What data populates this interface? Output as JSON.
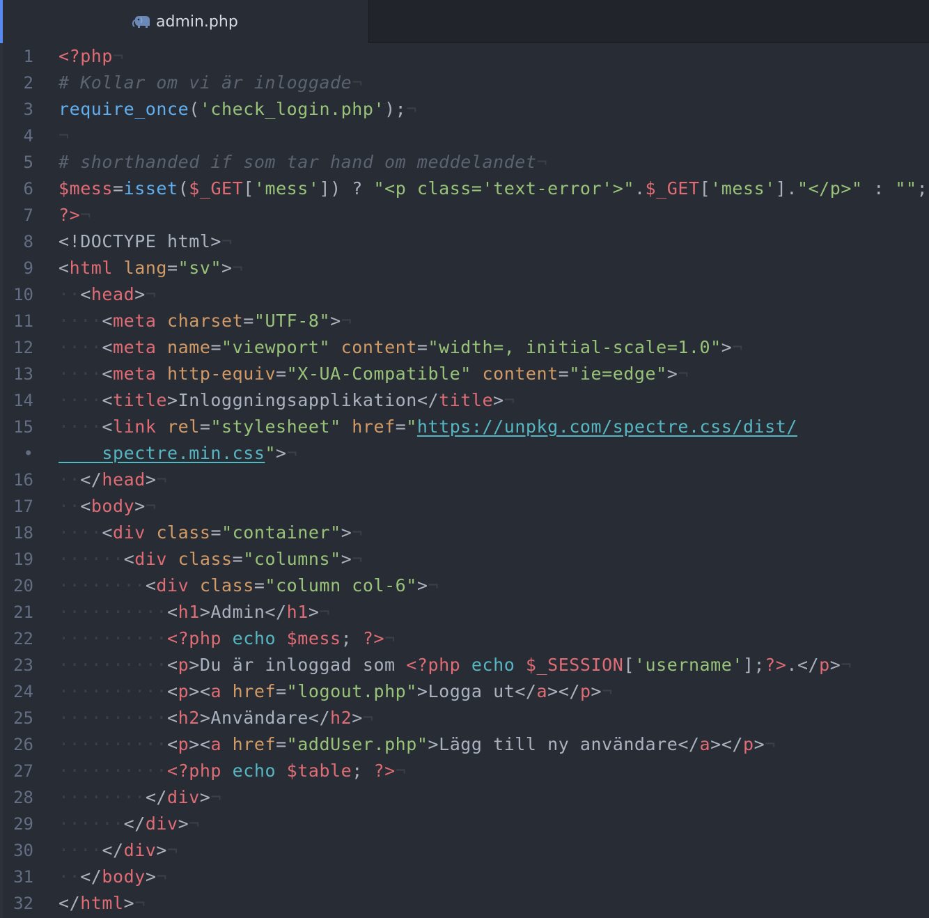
{
  "tab": {
    "filename": "admin.php",
    "icon": "php-elephant-icon"
  },
  "colors": {
    "background": "#282c34",
    "tab_bar": "#21252b",
    "accent": "#568af2",
    "gutter_text": "#636d83",
    "comment": "#5c6370",
    "tag": "#e06c75",
    "function": "#61afef",
    "string": "#98c379",
    "attribute": "#d19a66",
    "keyword": "#56b6c2",
    "plain": "#abb2bf",
    "invisible": "#3b4048"
  },
  "lines": [
    {
      "n": "1",
      "tokens": [
        [
          "ph",
          "<?php"
        ],
        [
          "eol",
          "¬"
        ]
      ]
    },
    {
      "n": "2",
      "tokens": [
        [
          "cm",
          "# Kollar om vi är inloggade"
        ],
        [
          "eol",
          "¬"
        ]
      ]
    },
    {
      "n": "3",
      "tokens": [
        [
          "fn",
          "require_once"
        ],
        [
          "pn",
          "("
        ],
        [
          "st",
          "'check_login.php'"
        ],
        [
          "pn",
          ");"
        ],
        [
          "eol",
          "¬"
        ]
      ]
    },
    {
      "n": "4",
      "tokens": [
        [
          "eol",
          "¬"
        ]
      ]
    },
    {
      "n": "5",
      "tokens": [
        [
          "cm",
          "# shorthanded if som tar hand om meddelandet"
        ],
        [
          "eol",
          "¬"
        ]
      ]
    },
    {
      "n": "6",
      "tokens": [
        [
          "vr",
          "$mess"
        ],
        [
          "pn",
          "="
        ],
        [
          "fn",
          "isset"
        ],
        [
          "pn",
          "("
        ],
        [
          "vr",
          "$_GET"
        ],
        [
          "pn",
          "["
        ],
        [
          "st",
          "'mess'"
        ],
        [
          "pn",
          "]) ? "
        ],
        [
          "st",
          "\"<p class='text-error'>\""
        ],
        [
          "pn",
          "."
        ],
        [
          "vr",
          "$_GET"
        ],
        [
          "pn",
          "["
        ],
        [
          "st",
          "'mess'"
        ],
        [
          "pn",
          "]."
        ],
        [
          "st",
          "\"</p>\""
        ],
        [
          "pn",
          " : "
        ],
        [
          "st",
          "\"\""
        ],
        [
          "pn",
          ";"
        ]
      ]
    },
    {
      "n": "7",
      "tokens": [
        [
          "ph",
          "?>"
        ],
        [
          "eol",
          "¬"
        ]
      ]
    },
    {
      "n": "8",
      "tokens": [
        [
          "ty",
          "<!DOCTYPE html>"
        ],
        [
          "eol",
          "¬"
        ]
      ]
    },
    {
      "n": "9",
      "tokens": [
        [
          "pn",
          "<"
        ],
        [
          "tg",
          "html"
        ],
        [
          "pn",
          " "
        ],
        [
          "at",
          "lang"
        ],
        [
          "pn",
          "="
        ],
        [
          "st",
          "\"sv\""
        ],
        [
          "pn",
          ">"
        ],
        [
          "eol",
          "¬"
        ]
      ]
    },
    {
      "n": "10",
      "tokens": [
        [
          "in",
          "··"
        ],
        [
          "pn",
          "<"
        ],
        [
          "tg",
          "head"
        ],
        [
          "pn",
          ">"
        ],
        [
          "eol",
          "¬"
        ]
      ]
    },
    {
      "n": "11",
      "tokens": [
        [
          "in",
          "····"
        ],
        [
          "pn",
          "<"
        ],
        [
          "tg",
          "meta"
        ],
        [
          "pn",
          " "
        ],
        [
          "at",
          "charset"
        ],
        [
          "pn",
          "="
        ],
        [
          "st",
          "\"UTF-8\""
        ],
        [
          "pn",
          ">"
        ],
        [
          "eol",
          "¬"
        ]
      ]
    },
    {
      "n": "12",
      "tokens": [
        [
          "in",
          "····"
        ],
        [
          "pn",
          "<"
        ],
        [
          "tg",
          "meta"
        ],
        [
          "pn",
          " "
        ],
        [
          "at",
          "name"
        ],
        [
          "pn",
          "="
        ],
        [
          "st",
          "\"viewport\""
        ],
        [
          "pn",
          " "
        ],
        [
          "at",
          "content"
        ],
        [
          "pn",
          "="
        ],
        [
          "st",
          "\"width=, initial-scale=1.0\""
        ],
        [
          "pn",
          ">"
        ],
        [
          "eol",
          "¬"
        ]
      ]
    },
    {
      "n": "13",
      "tokens": [
        [
          "in",
          "····"
        ],
        [
          "pn",
          "<"
        ],
        [
          "tg",
          "meta"
        ],
        [
          "pn",
          " "
        ],
        [
          "at",
          "http-equiv"
        ],
        [
          "pn",
          "="
        ],
        [
          "st",
          "\"X-UA-Compatible\""
        ],
        [
          "pn",
          " "
        ],
        [
          "at",
          "content"
        ],
        [
          "pn",
          "="
        ],
        [
          "st",
          "\"ie=edge\""
        ],
        [
          "pn",
          ">"
        ],
        [
          "eol",
          "¬"
        ]
      ]
    },
    {
      "n": "14",
      "tokens": [
        [
          "in",
          "····"
        ],
        [
          "pn",
          "<"
        ],
        [
          "tg",
          "title"
        ],
        [
          "pn",
          ">Inloggningsapplikation</"
        ],
        [
          "tg",
          "title"
        ],
        [
          "pn",
          ">"
        ],
        [
          "eol",
          "¬"
        ]
      ]
    },
    {
      "n": "15",
      "tokens": [
        [
          "in",
          "····"
        ],
        [
          "pn",
          "<"
        ],
        [
          "tg",
          "link"
        ],
        [
          "pn",
          " "
        ],
        [
          "at",
          "rel"
        ],
        [
          "pn",
          "="
        ],
        [
          "st",
          "\"stylesheet\""
        ],
        [
          "pn",
          " "
        ],
        [
          "at",
          "href"
        ],
        [
          "pn",
          "="
        ],
        [
          "st",
          "\""
        ],
        [
          "ur",
          "https://unpkg.com/spectre.css/dist/"
        ]
      ]
    },
    {
      "n": "•",
      "tokens": [
        [
          "wr",
          "    "
        ],
        [
          "ur",
          "spectre.min.css"
        ],
        [
          "st",
          "\""
        ],
        [
          "pn",
          ">"
        ],
        [
          "eol",
          "¬"
        ]
      ]
    },
    {
      "n": "16",
      "tokens": [
        [
          "in",
          "··"
        ],
        [
          "pn",
          "</"
        ],
        [
          "tg",
          "head"
        ],
        [
          "pn",
          ">"
        ],
        [
          "eol",
          "¬"
        ]
      ]
    },
    {
      "n": "17",
      "tokens": [
        [
          "in",
          "··"
        ],
        [
          "pn",
          "<"
        ],
        [
          "tg",
          "body"
        ],
        [
          "pn",
          ">"
        ],
        [
          "eol",
          "¬"
        ]
      ]
    },
    {
      "n": "18",
      "tokens": [
        [
          "in",
          "····"
        ],
        [
          "pn",
          "<"
        ],
        [
          "tg",
          "div"
        ],
        [
          "pn",
          " "
        ],
        [
          "at",
          "class"
        ],
        [
          "pn",
          "="
        ],
        [
          "st",
          "\"container\""
        ],
        [
          "pn",
          ">"
        ],
        [
          "eol",
          "¬"
        ]
      ]
    },
    {
      "n": "19",
      "tokens": [
        [
          "in",
          "······"
        ],
        [
          "pn",
          "<"
        ],
        [
          "tg",
          "div"
        ],
        [
          "pn",
          " "
        ],
        [
          "at",
          "class"
        ],
        [
          "pn",
          "="
        ],
        [
          "st",
          "\"columns\""
        ],
        [
          "pn",
          ">"
        ],
        [
          "eol",
          "¬"
        ]
      ]
    },
    {
      "n": "20",
      "tokens": [
        [
          "in",
          "········"
        ],
        [
          "pn",
          "<"
        ],
        [
          "tg",
          "div"
        ],
        [
          "pn",
          " "
        ],
        [
          "at",
          "class"
        ],
        [
          "pn",
          "="
        ],
        [
          "st",
          "\"column col-6\""
        ],
        [
          "pn",
          ">"
        ],
        [
          "eol",
          "¬"
        ]
      ]
    },
    {
      "n": "21",
      "tokens": [
        [
          "in",
          "··········"
        ],
        [
          "pn",
          "<"
        ],
        [
          "tg",
          "h1"
        ],
        [
          "pn",
          ">Admin</"
        ],
        [
          "tg",
          "h1"
        ],
        [
          "pn",
          ">"
        ],
        [
          "eol",
          "¬"
        ]
      ]
    },
    {
      "n": "22",
      "tokens": [
        [
          "in",
          "··········"
        ],
        [
          "ph",
          "<?php"
        ],
        [
          "pn",
          " "
        ],
        [
          "kw",
          "echo"
        ],
        [
          "pn",
          " "
        ],
        [
          "vr",
          "$mess"
        ],
        [
          "pn",
          "; "
        ],
        [
          "ph",
          "?>"
        ],
        [
          "eol",
          "¬"
        ]
      ]
    },
    {
      "n": "23",
      "tokens": [
        [
          "in",
          "··········"
        ],
        [
          "pn",
          "<"
        ],
        [
          "tg",
          "p"
        ],
        [
          "pn",
          ">Du är inloggad som "
        ],
        [
          "ph",
          "<?php"
        ],
        [
          "pn",
          " "
        ],
        [
          "kw",
          "echo"
        ],
        [
          "pn",
          " "
        ],
        [
          "vr",
          "$_SESSION"
        ],
        [
          "pn",
          "["
        ],
        [
          "st",
          "'username'"
        ],
        [
          "pn",
          "];"
        ],
        [
          "ph",
          "?>"
        ],
        [
          "pn",
          ".</"
        ],
        [
          "tg",
          "p"
        ],
        [
          "pn",
          ">"
        ],
        [
          "eol",
          "¬"
        ]
      ]
    },
    {
      "n": "24",
      "tokens": [
        [
          "in",
          "··········"
        ],
        [
          "pn",
          "<"
        ],
        [
          "tg",
          "p"
        ],
        [
          "pn",
          "><"
        ],
        [
          "tg",
          "a"
        ],
        [
          "pn",
          " "
        ],
        [
          "at",
          "href"
        ],
        [
          "pn",
          "="
        ],
        [
          "st",
          "\"logout.php\""
        ],
        [
          "pn",
          ">Logga ut</"
        ],
        [
          "tg",
          "a"
        ],
        [
          "pn",
          "></"
        ],
        [
          "tg",
          "p"
        ],
        [
          "pn",
          ">"
        ],
        [
          "eol",
          "¬"
        ]
      ]
    },
    {
      "n": "25",
      "tokens": [
        [
          "in",
          "··········"
        ],
        [
          "pn",
          "<"
        ],
        [
          "tg",
          "h2"
        ],
        [
          "pn",
          ">Användare</"
        ],
        [
          "tg",
          "h2"
        ],
        [
          "pn",
          ">"
        ],
        [
          "eol",
          "¬"
        ]
      ]
    },
    {
      "n": "26",
      "tokens": [
        [
          "in",
          "··········"
        ],
        [
          "pn",
          "<"
        ],
        [
          "tg",
          "p"
        ],
        [
          "pn",
          "><"
        ],
        [
          "tg",
          "a"
        ],
        [
          "pn",
          " "
        ],
        [
          "at",
          "href"
        ],
        [
          "pn",
          "="
        ],
        [
          "st",
          "\"addUser.php\""
        ],
        [
          "pn",
          ">Lägg till ny användare</"
        ],
        [
          "tg",
          "a"
        ],
        [
          "pn",
          "></"
        ],
        [
          "tg",
          "p"
        ],
        [
          "pn",
          ">"
        ],
        [
          "eol",
          "¬"
        ]
      ]
    },
    {
      "n": "27",
      "tokens": [
        [
          "in",
          "··········"
        ],
        [
          "ph",
          "<?php"
        ],
        [
          "pn",
          " "
        ],
        [
          "kw",
          "echo"
        ],
        [
          "pn",
          " "
        ],
        [
          "vr",
          "$table"
        ],
        [
          "pn",
          "; "
        ],
        [
          "ph",
          "?>"
        ],
        [
          "eol",
          "¬"
        ]
      ]
    },
    {
      "n": "28",
      "tokens": [
        [
          "in",
          "········"
        ],
        [
          "pn",
          "</"
        ],
        [
          "tg",
          "div"
        ],
        [
          "pn",
          ">"
        ],
        [
          "eol",
          "¬"
        ]
      ]
    },
    {
      "n": "29",
      "tokens": [
        [
          "in",
          "······"
        ],
        [
          "pn",
          "</"
        ],
        [
          "tg",
          "div"
        ],
        [
          "pn",
          ">"
        ],
        [
          "eol",
          "¬"
        ]
      ]
    },
    {
      "n": "30",
      "tokens": [
        [
          "in",
          "····"
        ],
        [
          "pn",
          "</"
        ],
        [
          "tg",
          "div"
        ],
        [
          "pn",
          ">"
        ],
        [
          "eol",
          "¬"
        ]
      ]
    },
    {
      "n": "31",
      "tokens": [
        [
          "in",
          "··"
        ],
        [
          "pn",
          "</"
        ],
        [
          "tg",
          "body"
        ],
        [
          "pn",
          ">"
        ],
        [
          "eol",
          "¬"
        ]
      ]
    },
    {
      "n": "32",
      "tokens": [
        [
          "pn",
          "</"
        ],
        [
          "tg",
          "html"
        ],
        [
          "pn",
          ">"
        ],
        [
          "eol",
          "¬"
        ]
      ]
    }
  ]
}
